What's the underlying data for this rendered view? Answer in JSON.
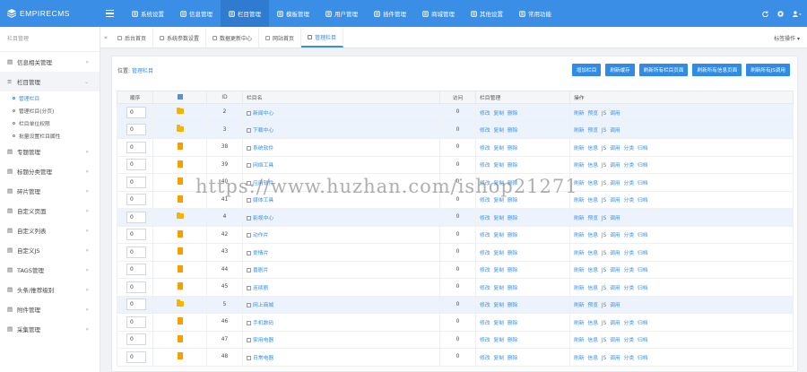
{
  "app": {
    "logo": "EMPIRECMS"
  },
  "topnav": [
    {
      "label": "系统设置",
      "icon": "gear-icon"
    },
    {
      "label": "信息管理",
      "icon": "edit-icon"
    },
    {
      "label": "栏目管理",
      "icon": "list-icon"
    },
    {
      "label": "模板管理",
      "icon": "template-icon"
    },
    {
      "label": "用户管理",
      "icon": "user-icon"
    },
    {
      "label": "插件管理",
      "icon": "plugin-icon"
    },
    {
      "label": "商城管理",
      "icon": "shop-icon"
    },
    {
      "label": "其他设置",
      "icon": "wrench-icon"
    },
    {
      "label": "常用功能",
      "icon": "star-icon"
    }
  ],
  "sidebar": {
    "title": "栏目管理",
    "items": [
      {
        "label": "信息相关管理",
        "icon": "doc-icon"
      },
      {
        "label": "栏目管理",
        "icon": "list-icon",
        "open": true
      },
      {
        "label": "专题管理",
        "icon": "topic-icon"
      },
      {
        "label": "标题分类管理",
        "icon": "tag-icon"
      },
      {
        "label": "碎片管理",
        "icon": "piece-icon"
      },
      {
        "label": "自定义页面",
        "icon": "page-icon"
      },
      {
        "label": "自定义列表",
        "icon": "list-icon"
      },
      {
        "label": "自定义JS",
        "icon": "code-icon"
      },
      {
        "label": "TAGS管理",
        "icon": "tags-icon"
      },
      {
        "label": "头条/推荐级别",
        "icon": "flag-icon"
      },
      {
        "label": "附件管理",
        "icon": "attach-icon"
      },
      {
        "label": "采集管理",
        "icon": "collect-icon"
      }
    ],
    "subitems": [
      {
        "label": "管理栏目",
        "active": true
      },
      {
        "label": "管理栏目(分页)",
        "active": false
      },
      {
        "label": "栏目单位权限",
        "active": false
      },
      {
        "label": "批量设置栏目属性",
        "active": false
      }
    ]
  },
  "tabs": [
    {
      "label": "后台首页",
      "active": false
    },
    {
      "label": "系统参数设置",
      "active": false
    },
    {
      "label": "数据更新中心",
      "active": false
    },
    {
      "label": "网站首页",
      "active": false
    },
    {
      "label": "管理栏目",
      "active": true
    }
  ],
  "tab_actions": "标签操作",
  "crumb": {
    "prefix": "位置:",
    "link": "管理栏目"
  },
  "buttons": [
    "增加栏目",
    "刷新缓存",
    "刷新所有栏目页面",
    "刷新所有信息页面",
    "刷新所有JS调用"
  ],
  "table": {
    "headers": [
      "顺序",
      "",
      "ID",
      "栏目名",
      "访问",
      "栏目管理",
      "操作"
    ],
    "rows": [
      {
        "order": "0",
        "type": "folder",
        "id": "2",
        "name": "新闻中心",
        "visits": "0",
        "manage": "修改 复制 删除",
        "ops": "刷新 预览 JS 调用",
        "cat": true
      },
      {
        "order": "0",
        "type": "folder",
        "id": "3",
        "name": "下载中心",
        "visits": "0",
        "manage": "修改 复制 删除",
        "ops": "刷新 预览 JS 调用",
        "cat": true
      },
      {
        "order": "0",
        "type": "file",
        "id": "38",
        "name": "系统软件",
        "visits": "0",
        "manage": "修改 复制 删除",
        "ops": "刷新 信息 JS 调用 分类 归档",
        "cat": false
      },
      {
        "order": "0",
        "type": "file",
        "id": "39",
        "name": "网络工具",
        "visits": "0",
        "manage": "修改 复制 删除",
        "ops": "刷新 信息 JS 调用 分类 归档",
        "cat": false
      },
      {
        "order": "0",
        "type": "file",
        "id": "40",
        "name": "应用软件",
        "visits": "0",
        "manage": "修改 复制 删除",
        "ops": "刷新 信息 JS 调用 分类 归档",
        "cat": false
      },
      {
        "order": "0",
        "type": "file",
        "id": "41",
        "name": "媒体工具",
        "visits": "0",
        "manage": "修改 复制 删除",
        "ops": "刷新 信息 JS 调用 分类 归档",
        "cat": false
      },
      {
        "order": "0",
        "type": "folder",
        "id": "4",
        "name": "影视中心",
        "visits": "0",
        "manage": "修改 复制 删除",
        "ops": "刷新 预览 JS 调用",
        "cat": true
      },
      {
        "order": "0",
        "type": "file",
        "id": "42",
        "name": "动作片",
        "visits": "0",
        "manage": "修改 复制 删除",
        "ops": "刷新 信息 JS 调用 分类 归档",
        "cat": false
      },
      {
        "order": "0",
        "type": "file",
        "id": "43",
        "name": "爱情片",
        "visits": "0",
        "manage": "修改 复制 删除",
        "ops": "刷新 信息 JS 调用 分类 归档",
        "cat": false
      },
      {
        "order": "0",
        "type": "file",
        "id": "44",
        "name": "喜剧片",
        "visits": "0",
        "manage": "修改 复制 删除",
        "ops": "刷新 信息 JS 调用 分类 归档",
        "cat": false
      },
      {
        "order": "0",
        "type": "file",
        "id": "45",
        "name": "连续剧",
        "visits": "0",
        "manage": "修改 复制 删除",
        "ops": "刷新 信息 JS 调用 分类 归档",
        "cat": false
      },
      {
        "order": "0",
        "type": "folder",
        "id": "5",
        "name": "网上商城",
        "visits": "0",
        "manage": "修改 复制 删除",
        "ops": "刷新 预览 JS 调用",
        "cat": true
      },
      {
        "order": "0",
        "type": "file",
        "id": "46",
        "name": "手机数码",
        "visits": "0",
        "manage": "修改 复制 删除",
        "ops": "刷新 信息 JS 调用 分类 归档",
        "cat": false
      },
      {
        "order": "0",
        "type": "file",
        "id": "47",
        "name": "家用电器",
        "visits": "0",
        "manage": "修改 复制 删除",
        "ops": "刷新 信息 JS 调用 分类 归档",
        "cat": false
      },
      {
        "order": "0",
        "type": "file",
        "id": "48",
        "name": "日常电器",
        "visits": "0",
        "manage": "修改 复制 删除",
        "ops": "刷新 信息 JS 调用 分类 归档",
        "cat": false
      }
    ]
  },
  "watermark": "https://www.huzhan.com/ishop21271",
  "colors": {
    "primary": "#3a8ee6",
    "category_row": "#edf3fc",
    "folder": "#f4b400"
  }
}
